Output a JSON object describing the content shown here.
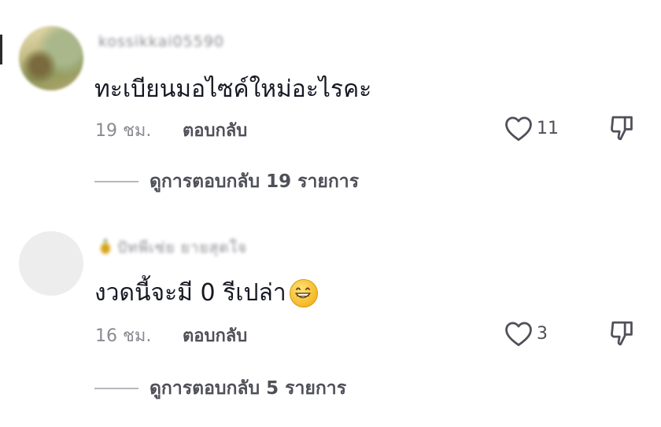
{
  "comments": [
    {
      "username": "kossikkai05590",
      "text": "ทะเบียนมอไซค์ใหม่อะไรคะ",
      "time": "19 ชม.",
      "reply_label": "ตอบกลับ",
      "likes": "11",
      "view_replies": "ดูการตอบกลับ 19 รายการ"
    },
    {
      "username": "ปัทพีเซ่ย ยายสุดใจ",
      "text": "งวดนี้จะมี 0 รีเปล่า",
      "time": "16 ชม.",
      "reply_label": "ตอบกลับ",
      "likes": "3",
      "view_replies": "ดูการตอบกลับ 5 รายการ"
    }
  ],
  "icons": {
    "like": "heart-outline-icon",
    "dislike": "thumbs-down-icon",
    "text_emoji": "grinning-face-emoji"
  }
}
